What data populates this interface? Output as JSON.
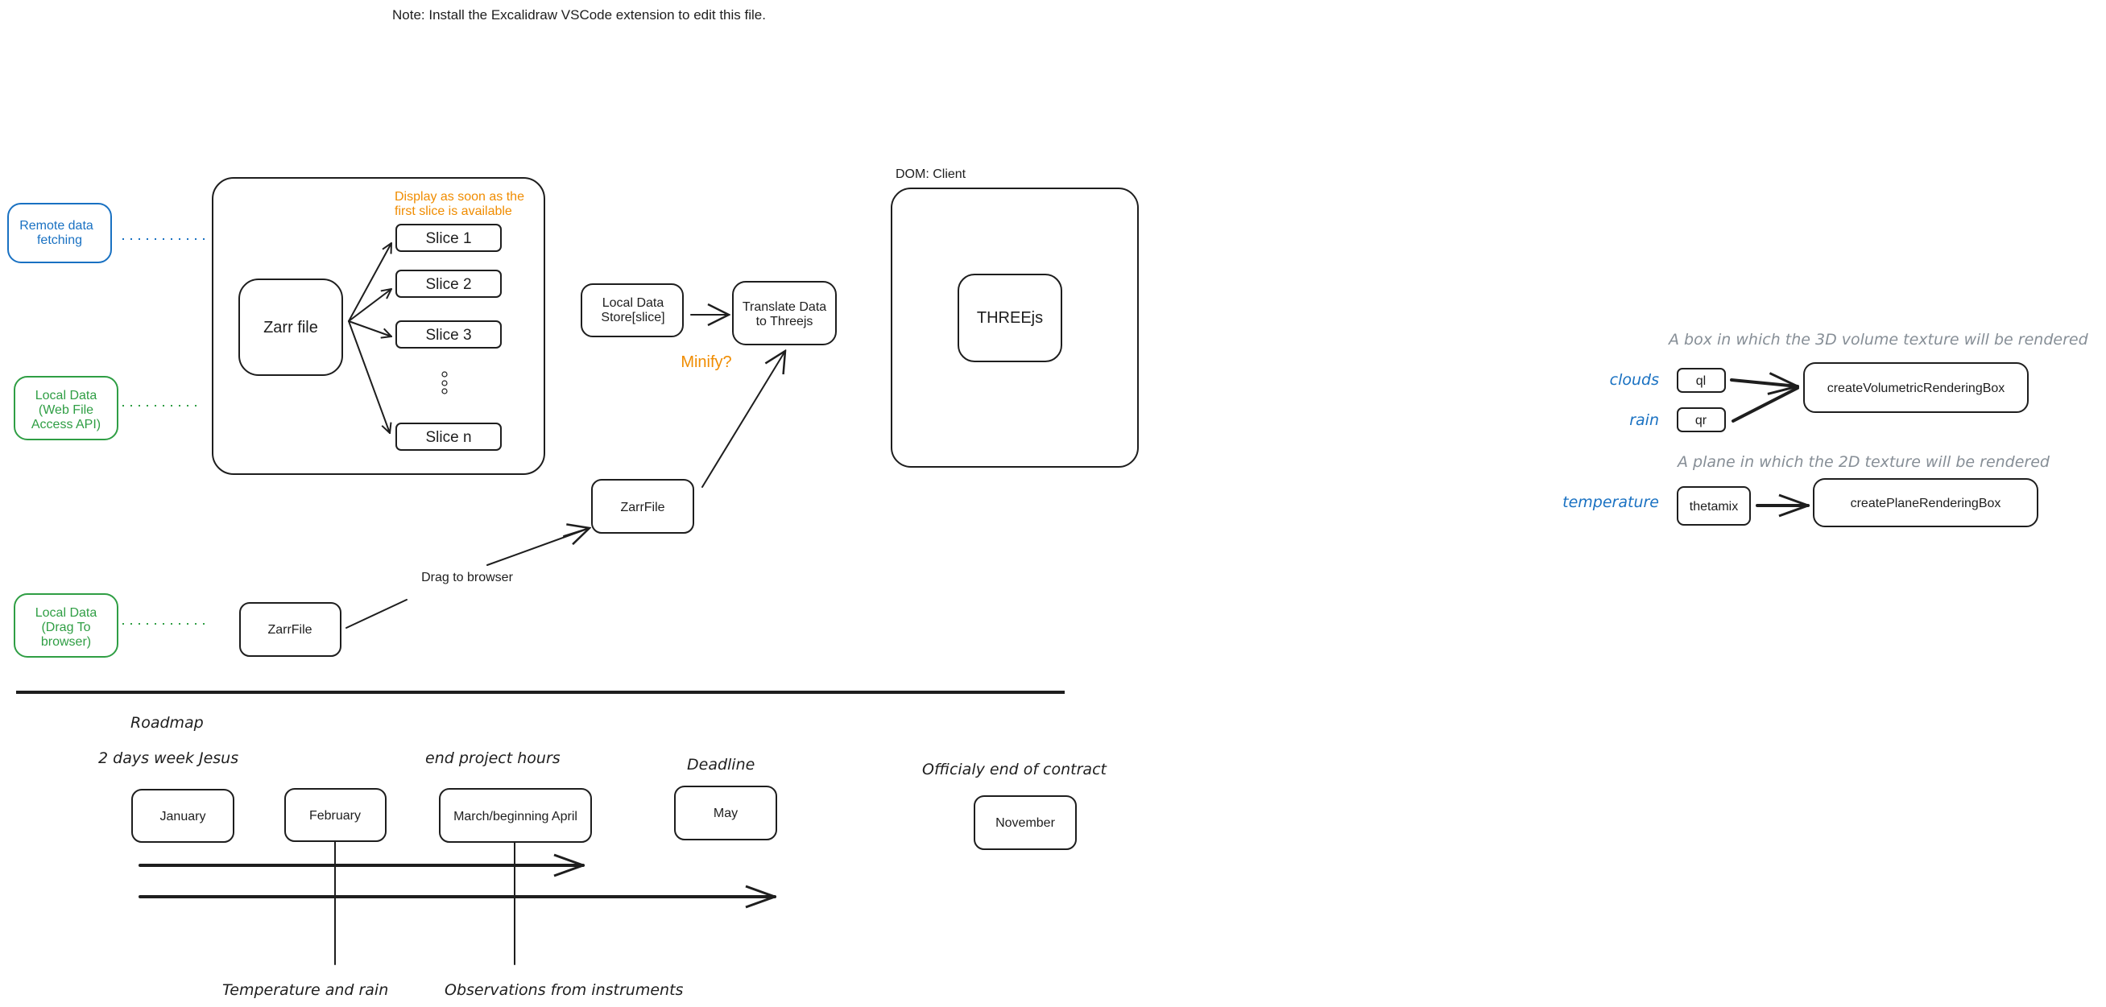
{
  "note": "Note: Install the Excalidraw VSCode extension to edit this file.",
  "sources": {
    "remote": [
      "Remote data",
      "fetching"
    ],
    "local_wfa": [
      "Local Data",
      "(Web File",
      "Access API)"
    ],
    "local_drag": [
      "Local Data",
      "(Drag To",
      "browser)"
    ]
  },
  "zarr_container": {
    "zarr_file": "Zarr file",
    "annotation": [
      "Display as soon as the",
      "first slice is available"
    ],
    "slices": [
      "Slice 1",
      "Slice 2",
      "Slice 3",
      "Slice n"
    ],
    "ellipsis": "..."
  },
  "pipeline": {
    "local_store": [
      "Local Data",
      "Store[slice]"
    ],
    "translate": [
      "Translate Data",
      "to Threejs"
    ],
    "minify": "Minify?",
    "zarrfile_mid": "ZarrFile",
    "zarrfile_bottom": "ZarrFile",
    "drag_label": "Drag to browser"
  },
  "dom_client": {
    "label": "DOM: Client",
    "threejs": "THREEjs"
  },
  "rendering": {
    "volume_caption": "A box in which the 3D volume texture will be rendered",
    "plane_caption": "A plane in which the 2D texture will be rendered",
    "inputs": [
      {
        "label": "clouds",
        "var": "ql"
      },
      {
        "label": "rain",
        "var": "qr"
      },
      {
        "label": "temperature",
        "var": "thetamix"
      }
    ],
    "volume_fn": "createVolumetricRenderingBox",
    "plane_fn": "createPlaneRenderingBox"
  },
  "roadmap": {
    "title": "Roadmap",
    "notes": {
      "jesus": "2 days week Jesus",
      "end_hours": "end project hours",
      "deadline": "Deadline",
      "contract": "Officialy end of contract"
    },
    "months": [
      "January",
      "February",
      "March/beginning April",
      "May",
      "November"
    ],
    "bottom_labels": [
      "Temperature and rain",
      "Observations from instruments"
    ]
  },
  "colors": {
    "stroke": "#1e1e1e",
    "blue": "#1971c2",
    "green": "#2f9e44",
    "orange": "#f08c00",
    "gray": "#868e96"
  }
}
